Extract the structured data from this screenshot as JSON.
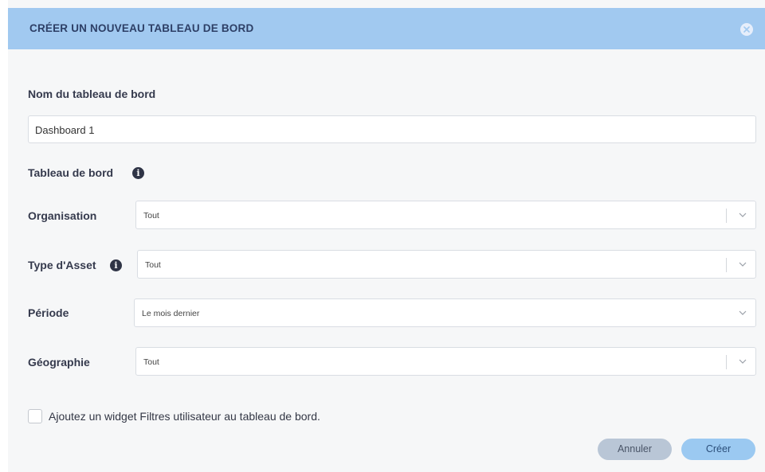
{
  "dialog": {
    "title": "CRÉER UN NOUVEAU TABLEAU DE BORD",
    "close_icon": "close-icon"
  },
  "form": {
    "name_label": "Nom du tableau de bord",
    "name_value": "Dashboard 1",
    "section_label": "Tableau de bord",
    "organisation_label": "Organisation",
    "organisation_value": "Tout",
    "asset_type_label": "Type d'Asset",
    "asset_type_value": "Tout",
    "period_label": "Période",
    "period_value": "Le mois dernier",
    "geography_label": "Géographie",
    "geography_value": "Tout",
    "checkbox_label": "Ajoutez un widget Filtres utilisateur au tableau de bord.",
    "checkbox_checked": false
  },
  "buttons": {
    "cancel": "Annuler",
    "create": "Créer"
  },
  "colors": {
    "header_bg": "#a1c9f0",
    "dialog_bg": "#f6f7f8",
    "primary_button": "#9bc9f1",
    "secondary_button": "#b9c6d6"
  }
}
